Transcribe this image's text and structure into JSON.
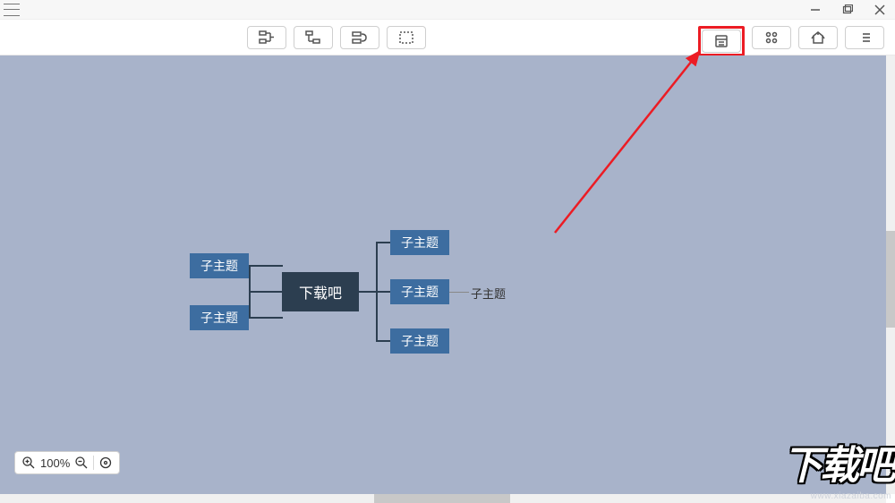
{
  "window": {
    "minimize_tip": "Minimize",
    "maximize_tip": "Maximize",
    "close_tip": "Close"
  },
  "mindmap": {
    "central": "下载吧",
    "left_children": [
      "子主题",
      "子主题"
    ],
    "right_children": [
      "子主题",
      "子主题",
      "子主题"
    ],
    "leaf": "子主题"
  },
  "zoom": {
    "level": "100%"
  },
  "watermark": {
    "brand": "下载吧",
    "url": "www.xiazaiba.com"
  },
  "annotation": {
    "arrow_color": "#ec1c24"
  }
}
